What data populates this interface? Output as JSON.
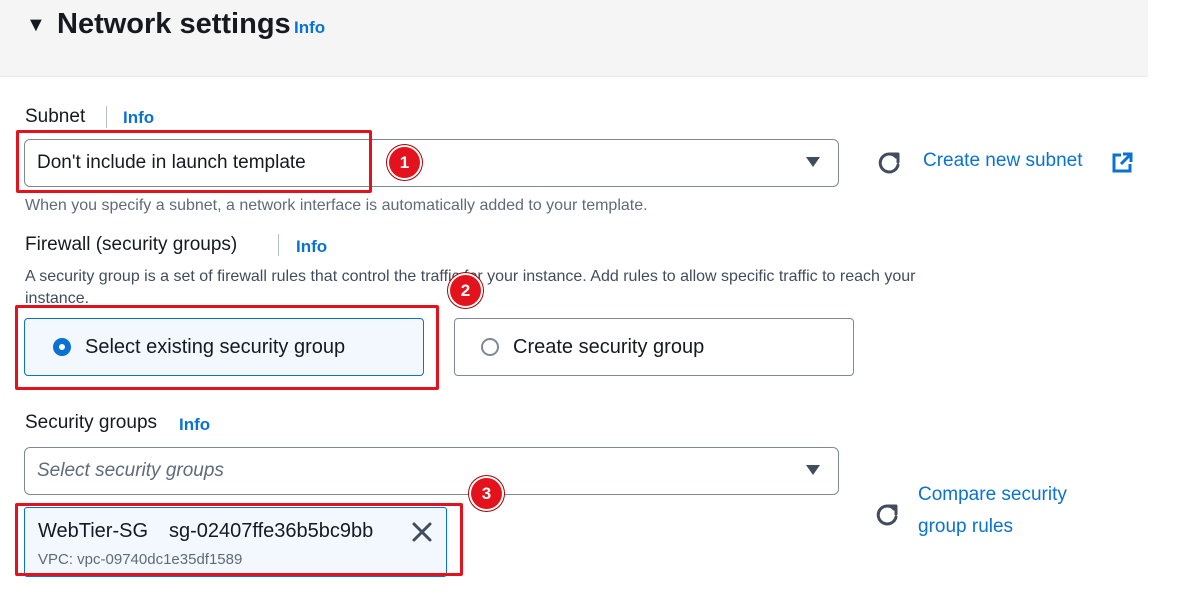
{
  "section": {
    "title": "Network settings",
    "info": "Info"
  },
  "subnet": {
    "label": "Subnet",
    "info": "Info",
    "value": "Don't include in launch template",
    "help": "When you specify a subnet, a network interface is automatically added to your template.",
    "create_link": "Create new subnet"
  },
  "firewall": {
    "label": "Firewall (security groups)",
    "info": "Info",
    "description_line1": "A security group is a set of firewall rules that control the traffic for your instance. Add rules to allow specific traffic to reach your",
    "description_line2": "instance.",
    "options": [
      {
        "label": "Select existing security group",
        "selected": true
      },
      {
        "label": "Create security group",
        "selected": false
      }
    ]
  },
  "security_groups": {
    "label": "Security groups",
    "info": "Info",
    "placeholder": "Select security groups",
    "compare_link_line1": "Compare security",
    "compare_link_line2": "group rules",
    "token": {
      "name": "WebTier-SG",
      "id": "sg-02407ffe36b5bc9bb",
      "vpc": "VPC: vpc-09740dc1e35df1589"
    }
  },
  "annotations": [
    "1",
    "2",
    "3"
  ],
  "colors": {
    "accent": "#0972d3",
    "annotation_red": "#e3121c",
    "header_bg": "#f5f5f5"
  }
}
